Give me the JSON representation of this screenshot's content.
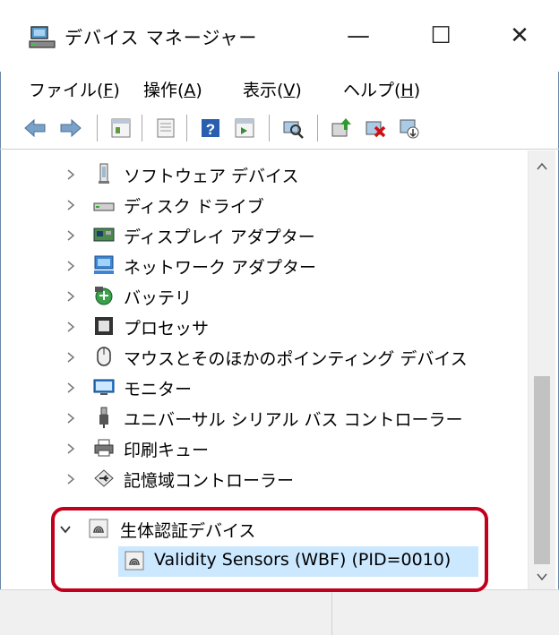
{
  "window": {
    "title": "デバイス マネージャー",
    "minimize": "—",
    "maximize": "☐",
    "close": "✕"
  },
  "menu": [
    {
      "label": "ファイル(",
      "key": "F",
      "end": ")"
    },
    {
      "label": "操作(",
      "key": "A",
      "end": ")"
    },
    {
      "label": "表示(",
      "key": "V",
      "end": ")"
    },
    {
      "label": "ヘルプ(",
      "key": "H",
      "end": ")"
    }
  ],
  "toolbar": {
    "icons": [
      "back-icon",
      "forward-icon",
      "properties-icon",
      "update-driver-icon",
      "help-icon",
      "action-icon",
      "scan-hardware-icon",
      "update-icon",
      "uninstall-icon",
      "enable-icon"
    ]
  },
  "tree": {
    "items": [
      {
        "label": "ソフトウェア デバイス",
        "icon": "software-device-icon"
      },
      {
        "label": "ディスク ドライブ",
        "icon": "disk-drive-icon"
      },
      {
        "label": "ディスプレイ アダプター",
        "icon": "display-adapter-icon"
      },
      {
        "label": "ネットワーク アダプター",
        "icon": "network-adapter-icon"
      },
      {
        "label": "バッテリ",
        "icon": "battery-icon"
      },
      {
        "label": "プロセッサ",
        "icon": "processor-icon"
      },
      {
        "label": "マウスとそのほかのポインティング デバイス",
        "icon": "mouse-icon"
      },
      {
        "label": "モニター",
        "icon": "monitor-icon"
      },
      {
        "label": "ユニバーサル シリアル バス コントローラー",
        "icon": "usb-icon"
      },
      {
        "label": "印刷キュー",
        "icon": "printer-icon"
      },
      {
        "label": "記憶域コントローラー",
        "icon": "storage-controller-icon"
      }
    ],
    "expanded": {
      "label": "生体認証デバイス",
      "icon": "fingerprint-icon",
      "child": {
        "label": "Validity Sensors (WBF) (PID=0010)",
        "icon": "fingerprint-icon"
      }
    }
  },
  "colors": {
    "selection": "#cce8ff",
    "highlight_border": "#c0001c"
  }
}
